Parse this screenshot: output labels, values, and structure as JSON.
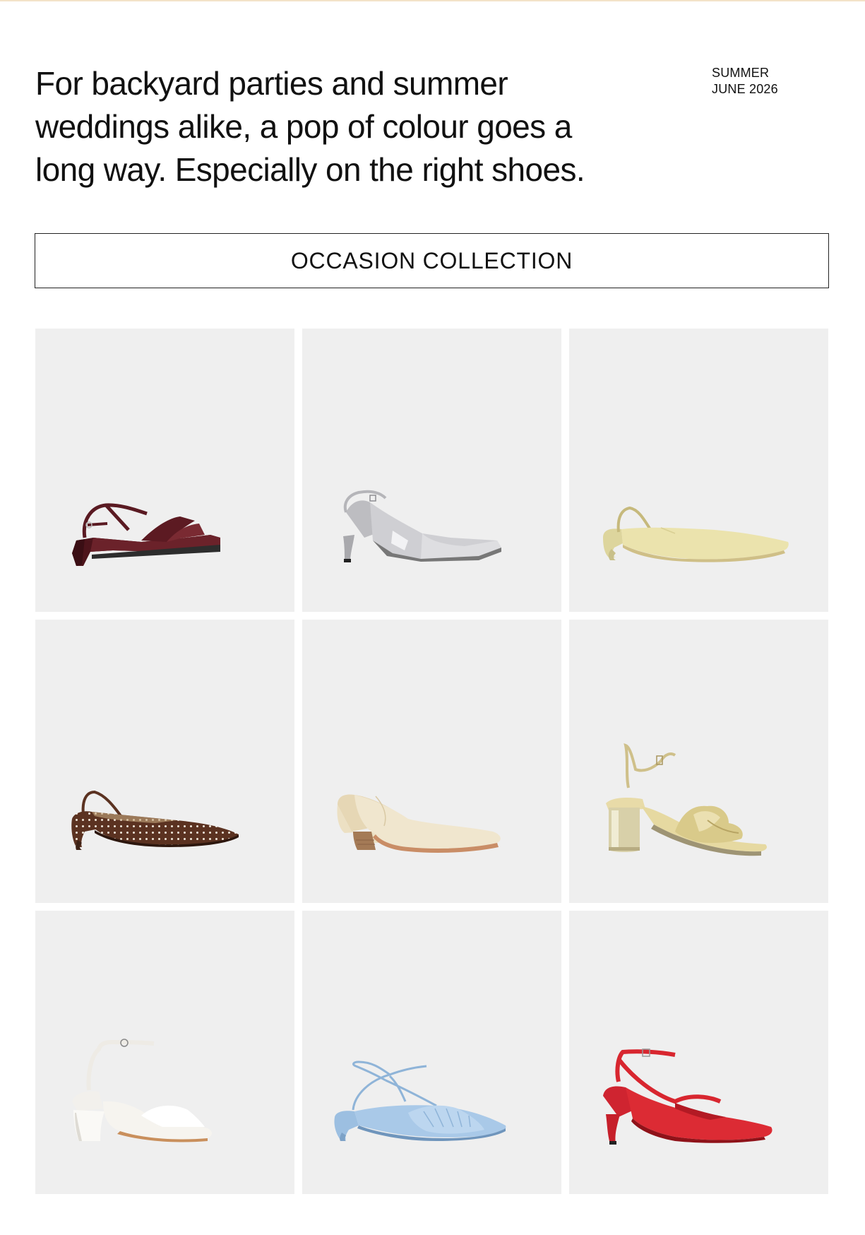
{
  "hero": {
    "lines": [
      "For backyard parties and summer",
      "weddings alike, a pop of colour goes a",
      "long way. Especially on the right shoes."
    ]
  },
  "meta": {
    "season": "SUMMER",
    "date": "JUNE 2026"
  },
  "collection_button": {
    "label": "OCCASION COLLECTION"
  },
  "products": [
    {
      "name": "burgundy-croc-strappy-sandal",
      "color": "#5a1a22"
    },
    {
      "name": "silver-slingback-pump",
      "color": "#c9c9cc"
    },
    {
      "name": "butter-pony-hair-slingback-mule",
      "color": "#e9e1a9"
    },
    {
      "name": "brown-polka-dot-slingback",
      "color": "#5b3221"
    },
    {
      "name": "cream-leather-block-heel-pump",
      "color": "#ece1c7"
    },
    {
      "name": "gold-knot-block-heel-sandal",
      "color": "#d8c98f"
    },
    {
      "name": "white-ankle-strap-block-sandal",
      "color": "#f4f2ee"
    },
    {
      "name": "pale-blue-lace-up-ruched-flat",
      "color": "#a9c9e8"
    },
    {
      "name": "red-asymmetric-strap-pump",
      "color": "#d8262f"
    }
  ]
}
